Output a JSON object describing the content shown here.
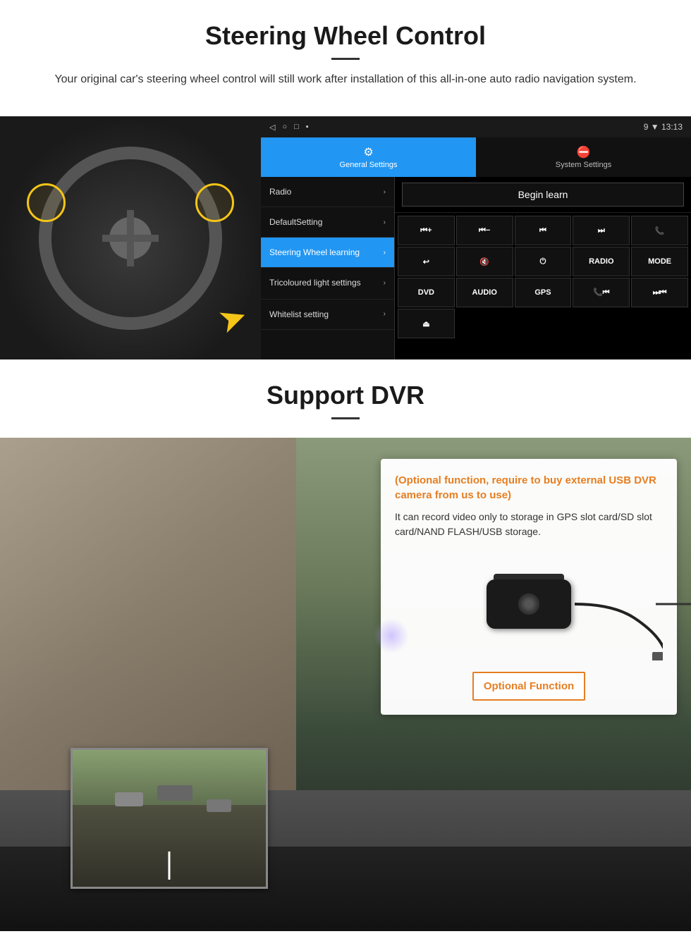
{
  "page": {
    "section1": {
      "title": "Steering Wheel Control",
      "subtitle": "Your original car's steering wheel control will still work after installation of this all-in-one auto radio navigation system.",
      "android_ui": {
        "statusbar": {
          "icons": [
            "◁",
            "○",
            "□",
            "▪"
          ],
          "signal": "9 ▼ 13:13"
        },
        "tabs": [
          {
            "icon": "⚙",
            "label": "General Settings",
            "active": true
          },
          {
            "icon": "⛔",
            "label": "System Settings",
            "active": false
          }
        ],
        "menu_items": [
          {
            "label": "Radio",
            "active": false
          },
          {
            "label": "DefaultSetting",
            "active": false
          },
          {
            "label": "Steering Wheel learning",
            "active": true
          },
          {
            "label": "Tricoloured light settings",
            "active": false
          },
          {
            "label": "Whitelist setting",
            "active": false
          }
        ],
        "begin_learn": "Begin learn",
        "control_buttons": [
          {
            "label": "⏮+"
          },
          {
            "label": "⏮−"
          },
          {
            "label": "⏮"
          },
          {
            "label": "⏭"
          },
          {
            "label": "📞"
          },
          {
            "label": "↩"
          },
          {
            "label": "🔇"
          },
          {
            "label": "⏻"
          },
          {
            "label": "RADIO"
          },
          {
            "label": "MODE"
          },
          {
            "label": "DVD"
          },
          {
            "label": "AUDIO"
          },
          {
            "label": "GPS"
          },
          {
            "label": "📞⏮"
          },
          {
            "label": "⏭⏮"
          },
          {
            "label": "⏏"
          }
        ]
      }
    },
    "section2": {
      "title": "Support DVR",
      "dvr_card": {
        "optional_notice": "(Optional function, require to buy external USB DVR camera from us to use)",
        "description": "It can record video only to storage in GPS slot card/SD slot card/NAND FLASH/USB storage.",
        "button_label": "Optional Function"
      }
    }
  }
}
